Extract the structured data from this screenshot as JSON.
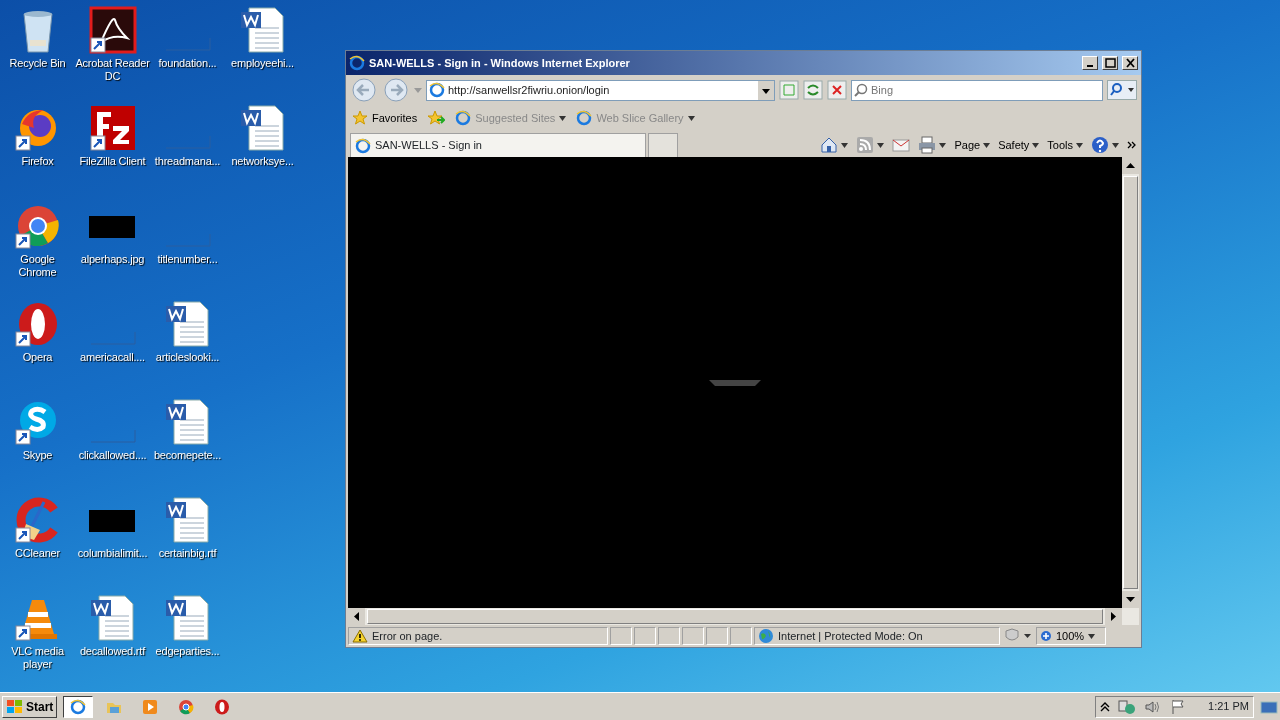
{
  "desktop_columns": [
    [
      {
        "label": "Recycle Bin",
        "kind": "recycle",
        "shortcut": false
      },
      {
        "label": "Firefox",
        "kind": "firefox",
        "shortcut": true
      },
      {
        "label": "Google Chrome",
        "kind": "chrome",
        "shortcut": true
      },
      {
        "label": "Opera",
        "kind": "opera",
        "shortcut": true
      },
      {
        "label": "Skype",
        "kind": "skype",
        "shortcut": true
      },
      {
        "label": "CCleaner",
        "kind": "ccleaner",
        "shortcut": true
      },
      {
        "label": "VLC media player",
        "kind": "vlc",
        "shortcut": true
      }
    ],
    [
      {
        "label": "Acrobat Reader DC",
        "kind": "acrobat",
        "shortcut": true
      },
      {
        "label": "FileZilla Client",
        "kind": "filezilla",
        "shortcut": true
      },
      {
        "label": "alperhaps.jpg",
        "kind": "image",
        "shortcut": false
      },
      {
        "label": "americacall....",
        "kind": "blank",
        "shortcut": false
      },
      {
        "label": "clickallowed....",
        "kind": "blank",
        "shortcut": false
      },
      {
        "label": "columbialimit...",
        "kind": "image",
        "shortcut": false
      },
      {
        "label": "decallowed.rtf",
        "kind": "word",
        "shortcut": false
      }
    ],
    [
      {
        "label": "foundation...",
        "kind": "blank",
        "shortcut": false
      },
      {
        "label": "threadmana...",
        "kind": "blank",
        "shortcut": false
      },
      {
        "label": "titlenumber...",
        "kind": "blank",
        "shortcut": false
      },
      {
        "label": "articleslooki...",
        "kind": "word",
        "shortcut": false
      },
      {
        "label": "becomepete...",
        "kind": "word",
        "shortcut": false
      },
      {
        "label": "certainbig.rtf",
        "kind": "word",
        "shortcut": false
      },
      {
        "label": "edgeparties...",
        "kind": "word",
        "shortcut": false
      }
    ],
    [
      {
        "label": "employeehi...",
        "kind": "word",
        "shortcut": false
      },
      {
        "label": "networksye...",
        "kind": "word",
        "shortcut": false
      }
    ]
  ],
  "window": {
    "title": "SAN-WELLS - Sign in - Windows Internet Explorer",
    "address": "http://sanwellsr2fiwriu.onion/login",
    "search_placeholder": "Bing",
    "favorites_bar": [
      {
        "label": "Favorites",
        "kind": "star"
      },
      {
        "label": "Suggested Sites",
        "kind": "ie"
      },
      {
        "label": "Web Slice Gallery",
        "kind": "ie"
      }
    ],
    "tabs": [
      {
        "label": "SAN-WELLS - Sign in",
        "selected": true
      },
      {
        "selected": false
      }
    ],
    "commands": [
      {
        "kind": "home"
      },
      {
        "kind": "feeds"
      },
      {
        "kind": "mail"
      },
      {
        "kind": "print"
      },
      {
        "kind": "menu",
        "label": "Page"
      },
      {
        "kind": "menu",
        "label": "Safety"
      },
      {
        "kind": "menu",
        "label": "Tools"
      },
      {
        "kind": "help"
      }
    ],
    "status": {
      "message": "Error on page.",
      "zone": "Internet | Protected Mode: On",
      "zoom": "100%"
    }
  },
  "taskbar": {
    "start": "Start",
    "apps": [
      {
        "kind": "ie",
        "selected": true
      },
      {
        "kind": "folder",
        "selected": false
      },
      {
        "kind": "media",
        "selected": false
      },
      {
        "kind": "chrome",
        "selected": false
      },
      {
        "kind": "opera",
        "selected": false
      }
    ],
    "clock": "1:21 PM"
  }
}
